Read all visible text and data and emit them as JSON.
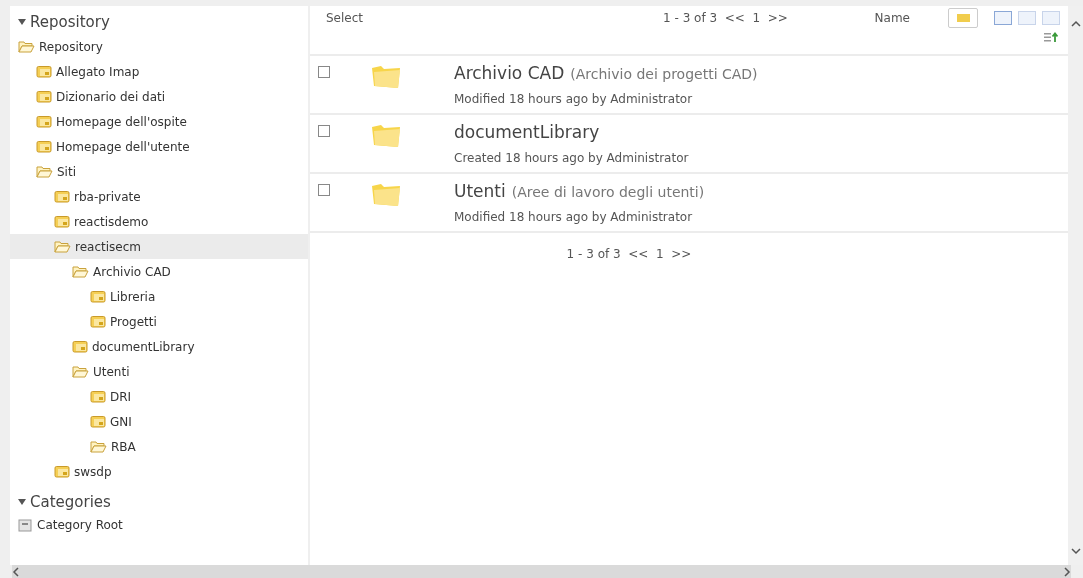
{
  "sidebar": {
    "sections": [
      {
        "title": "Repository",
        "expanded": true,
        "tree": [
          {
            "label": "Repository",
            "expanded": true,
            "selected": false,
            "children": [
              {
                "label": "Allegato Imap",
                "expanded": false,
                "selected": false
              },
              {
                "label": "Dizionario dei dati",
                "expanded": false,
                "selected": false
              },
              {
                "label": "Homepage dell'ospite",
                "expanded": false,
                "selected": false
              },
              {
                "label": "Homepage dell'utente",
                "expanded": false,
                "selected": false
              },
              {
                "label": "Siti",
                "expanded": true,
                "selected": false,
                "children": [
                  {
                    "label": "rba-private",
                    "expanded": false,
                    "selected": false
                  },
                  {
                    "label": "reactisdemo",
                    "expanded": false,
                    "selected": false
                  },
                  {
                    "label": "reactisecm",
                    "expanded": true,
                    "selected": true,
                    "children": [
                      {
                        "label": "Archivio CAD",
                        "expanded": true,
                        "selected": false,
                        "children": [
                          {
                            "label": "Libreria",
                            "expanded": false,
                            "selected": false
                          },
                          {
                            "label": "Progetti",
                            "expanded": false,
                            "selected": false
                          }
                        ]
                      },
                      {
                        "label": "documentLibrary",
                        "expanded": false,
                        "selected": false
                      },
                      {
                        "label": "Utenti",
                        "expanded": true,
                        "selected": false,
                        "children": [
                          {
                            "label": "DRI",
                            "expanded": false,
                            "selected": false
                          },
                          {
                            "label": "GNI",
                            "expanded": false,
                            "selected": false
                          },
                          {
                            "label": "RBA",
                            "expanded": true,
                            "selected": false
                          }
                        ]
                      }
                    ]
                  },
                  {
                    "label": "swsdp",
                    "expanded": false,
                    "selected": false
                  }
                ]
              }
            ]
          }
        ]
      },
      {
        "title": "Categories",
        "expanded": true,
        "tree": [
          {
            "label": "Category Root",
            "kind": "category",
            "selected": false
          }
        ]
      }
    ]
  },
  "toolbar": {
    "select_label": "Select",
    "pagination": "1 - 3 of 3  <<  1  >>",
    "sort_label": "Name"
  },
  "items": [
    {
      "name": "Archivio CAD",
      "description": "(Archivio dei progetti CAD)",
      "meta": "Modified 18 hours ago by Administrator",
      "checked": false
    },
    {
      "name": "documentLibrary",
      "meta": "Created 18 hours ago by Administrator",
      "checked": false
    },
    {
      "name": "Utenti",
      "description": "(Aree di lavoro degli utenti)",
      "meta": "Modified 18 hours ago by Administrator",
      "checked": false
    }
  ],
  "footer_pagination": "1 - 3 of 3  <<  1  >>"
}
